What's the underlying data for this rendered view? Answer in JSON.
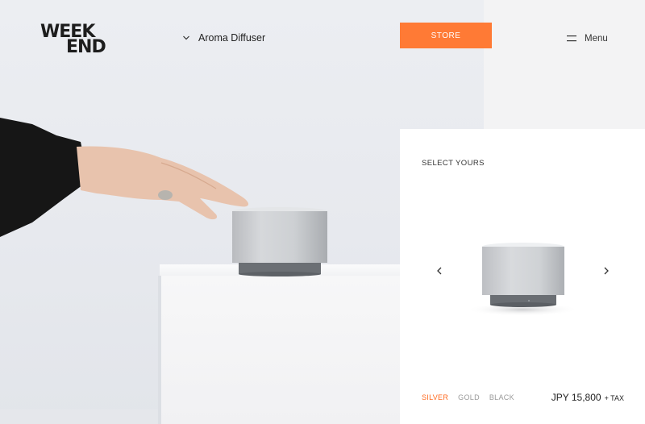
{
  "brand": {
    "logo_line1": "WEEK",
    "logo_line2": "END"
  },
  "header": {
    "product_label": "Aroma Diffuser",
    "store_label": "STORE",
    "menu_label": "Menu"
  },
  "panel": {
    "title": "SELECT YOURS",
    "colors": [
      {
        "label": "SILVER",
        "active": true
      },
      {
        "label": "GOLD",
        "active": false
      },
      {
        "label": "BLACK",
        "active": false
      }
    ],
    "price": "JPY 15,800",
    "tax": "+ TAX"
  },
  "icons": {
    "dropdown": "chevron-down-icon",
    "menu": "hamburger-icon",
    "prev": "chevron-left-icon",
    "next": "chevron-right-icon"
  },
  "colors": {
    "accent": "#ff7a35",
    "active_option": "#ff6a1f",
    "inactive_option": "#9a9a9a",
    "background": "#e9ebef",
    "panel": "#ffffff"
  }
}
